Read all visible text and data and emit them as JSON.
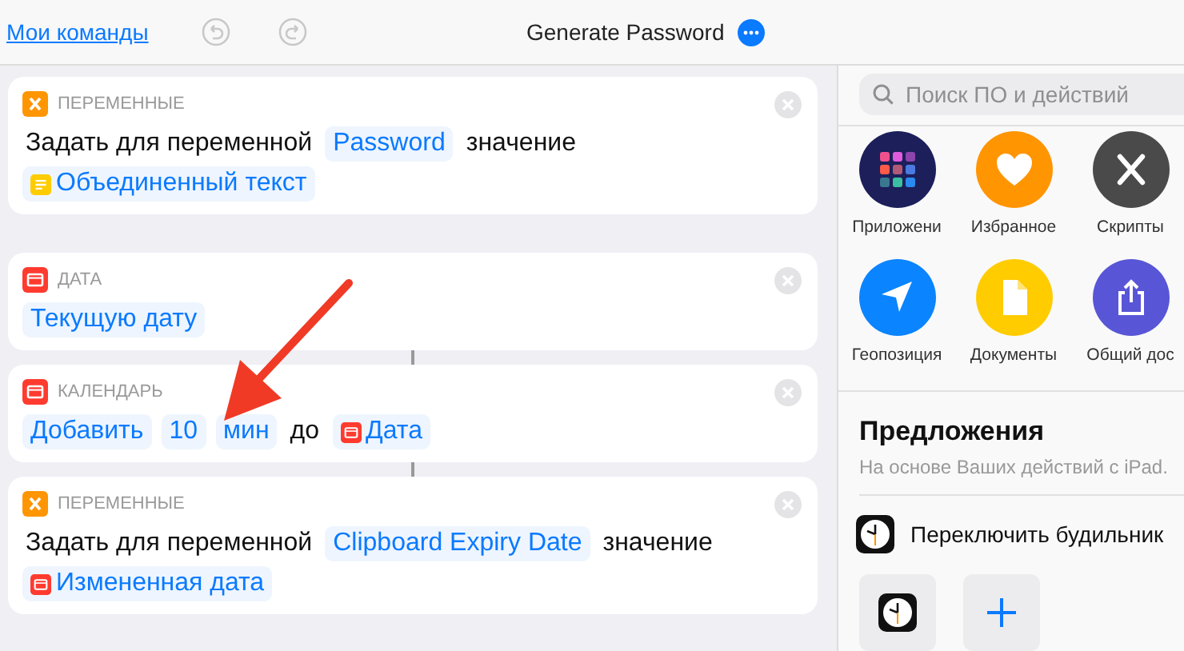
{
  "header": {
    "back_link": "Мои команды",
    "title": "Generate Password"
  },
  "actions": [
    {
      "category": "ПЕРЕМЕННЫЕ",
      "kind": "variable",
      "lines": [
        [
          {
            "kind": "text",
            "text": "Задать для переменной"
          },
          {
            "kind": "token",
            "text": "Password"
          },
          {
            "kind": "text",
            "text": "значение"
          }
        ],
        [
          {
            "kind": "text_variable",
            "text": "Объединенный текст"
          }
        ]
      ]
    },
    {
      "category": "ДАТА",
      "kind": "calendar",
      "lines": [
        [
          {
            "kind": "token",
            "text": "Текущую дату"
          }
        ]
      ]
    },
    {
      "category": "КАЛЕНДАРЬ",
      "kind": "calendar",
      "lines": [
        [
          {
            "kind": "token",
            "text": "Добавить"
          },
          {
            "kind": "token",
            "text": "10"
          },
          {
            "kind": "token",
            "text": "мин"
          },
          {
            "kind": "text",
            "text": "до"
          },
          {
            "kind": "date_variable",
            "text": "Дата"
          }
        ]
      ]
    },
    {
      "category": "ПЕРЕМЕННЫЕ",
      "kind": "variable",
      "lines": [
        [
          {
            "kind": "text",
            "text": "Задать для переменной"
          },
          {
            "kind": "token",
            "text": "Clipboard Expiry Date"
          },
          {
            "kind": "text",
            "text": "значение"
          }
        ],
        [
          {
            "kind": "date_variable",
            "text": "Измененная дата"
          }
        ]
      ]
    }
  ],
  "library": {
    "search": {
      "placeholder": "Поиск ПО и действий"
    },
    "categories": [
      {
        "label": "Приложени",
        "kind": "apps",
        "color": "#1c1f5a"
      },
      {
        "label": "Избранное",
        "kind": "heart",
        "color": "#ff9500"
      },
      {
        "label": "Скрипты",
        "kind": "variable",
        "color": "#4a4a4a"
      },
      {
        "label": "Геопозиция",
        "kind": "location",
        "color": "#0a84ff"
      },
      {
        "label": "Документы",
        "kind": "document",
        "color": "#ffcc00"
      },
      {
        "label": "Общий дос",
        "kind": "share",
        "color": "#5856d6"
      }
    ],
    "suggestions": {
      "title": "Предложения",
      "subtitle": "На основе Ваших действий с iPad.",
      "items": [
        {
          "label": "Переключить будильник"
        }
      ]
    }
  }
}
